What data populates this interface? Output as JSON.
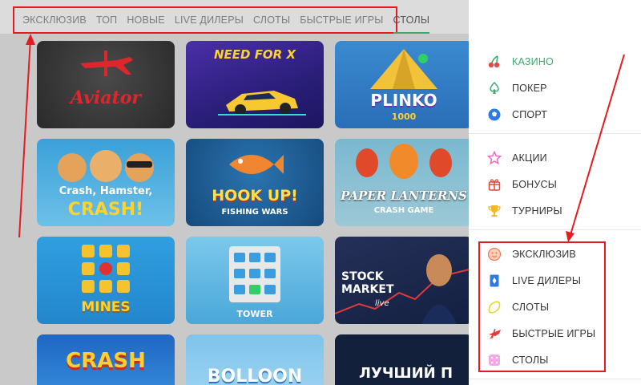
{
  "tabs": [
    {
      "label": "ЭКСКЛЮЗИВ",
      "active": false
    },
    {
      "label": "ТОП",
      "active": false
    },
    {
      "label": "НОВЫЕ",
      "active": false
    },
    {
      "label": "LIVE ДИЛЕРЫ",
      "active": false
    },
    {
      "label": "СЛОТЫ",
      "active": false
    },
    {
      "label": "БЫСТРЫЕ ИГРЫ",
      "active": false
    },
    {
      "label": "СТОЛЫ",
      "active": true
    }
  ],
  "games": [
    {
      "title": "Aviator"
    },
    {
      "title": "NEED FOR X"
    },
    {
      "title": "PLINKO",
      "sub": "1000"
    },
    {
      "title": "Crash, Hamster,",
      "sub": "CRASH!"
    },
    {
      "title": "HOOK UP!",
      "sub": "FISHING WARS"
    },
    {
      "title": "PAPER LANTERNS",
      "sub": "CRASH GAME"
    },
    {
      "title": "MINES"
    },
    {
      "title": "TOWER"
    },
    {
      "title": "STOCK MARKET",
      "sub": "live"
    },
    {
      "title": "CRASH"
    },
    {
      "title": "BOLLOON"
    },
    {
      "title": "ЛУЧШИЙ П"
    }
  ],
  "sidebar": {
    "accent_color": "#3ea66d",
    "items": [
      {
        "label": "КАЗИНО",
        "icon": "cherry-icon",
        "active": true
      },
      {
        "label": "ПОКЕР",
        "icon": "spade-icon"
      },
      {
        "label": "СПОРТ",
        "icon": "soccer-ball-icon"
      },
      {
        "label": "АКЦИИ",
        "icon": "star-icon"
      },
      {
        "label": "БОНУСЫ",
        "icon": "gift-icon"
      },
      {
        "label": "ТУРНИРЫ",
        "icon": "trophy-icon"
      },
      {
        "label": "ЭКСКЛЮЗИВ",
        "icon": "face-icon"
      },
      {
        "label": "LIVE ДИЛЕРЫ",
        "icon": "playing-card-icon"
      },
      {
        "label": "СЛОТЫ",
        "icon": "lemon-icon"
      },
      {
        "label": "БЫСТРЫЕ ИГРЫ",
        "icon": "rocket-icon"
      },
      {
        "label": "СТОЛЫ",
        "icon": "dice-icon"
      }
    ]
  },
  "annotation_color": "#e31b23"
}
